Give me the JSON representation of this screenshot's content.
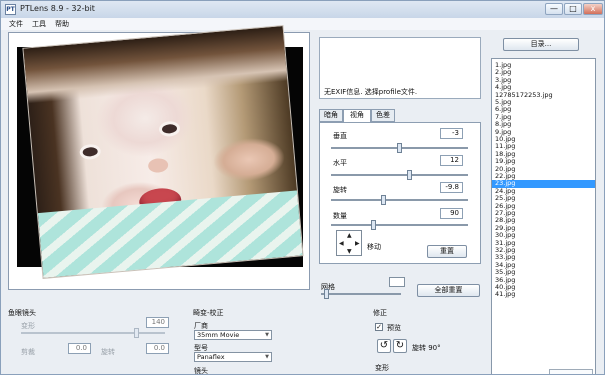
{
  "window": {
    "title": "PTLens 8.9 - 32-bit",
    "icon": "PT",
    "minimize": "—",
    "maximize": "□",
    "close": "x"
  },
  "menu": [
    "文件",
    "工具",
    "帮助"
  ],
  "exif": {
    "message": "无EXIF信息. 选择profile文件."
  },
  "tabs": [
    "暗角",
    "视角",
    "色差"
  ],
  "perspective": {
    "vertical_label": "垂直",
    "vertical_value": "-3",
    "horizontal_label": "水平",
    "horizontal_value": "12",
    "rotate_label": "旋转",
    "rotate_value": "-9.8",
    "amount_label": "数量",
    "amount_value": "90",
    "move_label": "移动",
    "reset_label": "重置"
  },
  "grid": {
    "label": "网格",
    "reset_all": "全部重置"
  },
  "directory_button": "目录...",
  "files": [
    "1.jpg",
    "2.jpg",
    "3.jpg",
    "4.jpg",
    "12785172253.jpg",
    "5.jpg",
    "6.jpg",
    "7.jpg",
    "8.jpg",
    "9.jpg",
    "10.jpg",
    "11.jpg",
    "18.jpg",
    "19.jpg",
    "20.jpg",
    "22.jpg",
    "23.jpg",
    "24.jpg",
    "25.jpg",
    "26.jpg",
    "27.jpg",
    "28.jpg",
    "29.jpg",
    "30.jpg",
    "31.jpg",
    "32.jpg",
    "33.jpg",
    "34.jpg",
    "35.jpg",
    "36.jpg",
    "40.jpg",
    "41.jpg"
  ],
  "selected_file": "23.jpg",
  "fisheye": {
    "title": "鱼眼镜头",
    "distortion_label": "变形",
    "distortion_value": "140",
    "cut_label": "剪裁",
    "cut_value": "0.0",
    "rotate_label": "旋转",
    "rotate_value": "0.0"
  },
  "lens": {
    "title": "畸变-校正",
    "maker_label": "厂商",
    "maker": "35mm Movie",
    "model_label": "型号",
    "model": "Panaflex",
    "lens_label": "镜头"
  },
  "correction": {
    "title": "修正",
    "preview_label": "预览",
    "rotate_label": "旋转 90°",
    "distortion_label": "变形"
  },
  "icons": [
    "app-icon",
    "arrow-up-icon",
    "arrow-down-icon",
    "arrow-left-icon",
    "arrow-right-icon",
    "rotate-left-icon",
    "rotate-right-icon"
  ]
}
